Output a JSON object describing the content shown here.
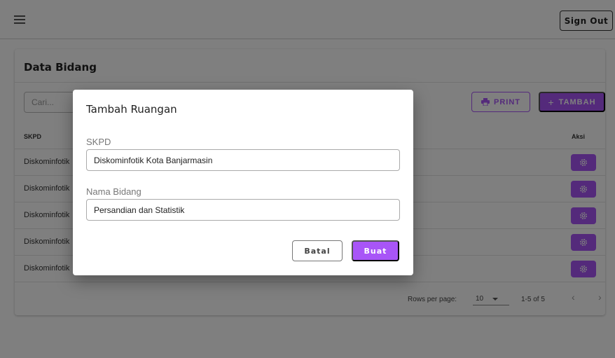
{
  "header": {
    "signout_label": "Sign Out"
  },
  "card": {
    "title": "Data Bidang",
    "search_placeholder": "Cari...",
    "print_label": "PRINT",
    "tambah_label": "TAMBAH",
    "columns": {
      "skpd": "SKPD",
      "aksi": "Aksi"
    },
    "rows": [
      {
        "skpd": "Diskominfotik"
      },
      {
        "skpd": "Diskominfotik"
      },
      {
        "skpd": "Diskominfotik"
      },
      {
        "skpd": "Diskominfotik"
      },
      {
        "skpd": "Diskominfotik"
      }
    ]
  },
  "pagination": {
    "rows_per_page_label": "Rows per page:",
    "rows_per_page_value": "10",
    "range_label": "1-5 of 5"
  },
  "dialog": {
    "title": "Tambah Ruangan",
    "skpd_label": "SKPD",
    "skpd_value": "Diskominfotik Kota Banjarmasin",
    "bidang_label": "Nama Bidang",
    "bidang_value": "Persandian dan Statistik",
    "cancel_label": "Batal",
    "submit_label": "Buat"
  },
  "colors": {
    "accent": "#a855f7"
  },
  "icons": {
    "menu": "hamburger-icon",
    "print": "printer-icon",
    "add": "plus-icon",
    "action": "gear-icon",
    "prev": "chevron-left-icon",
    "next": "chevron-right-icon"
  }
}
